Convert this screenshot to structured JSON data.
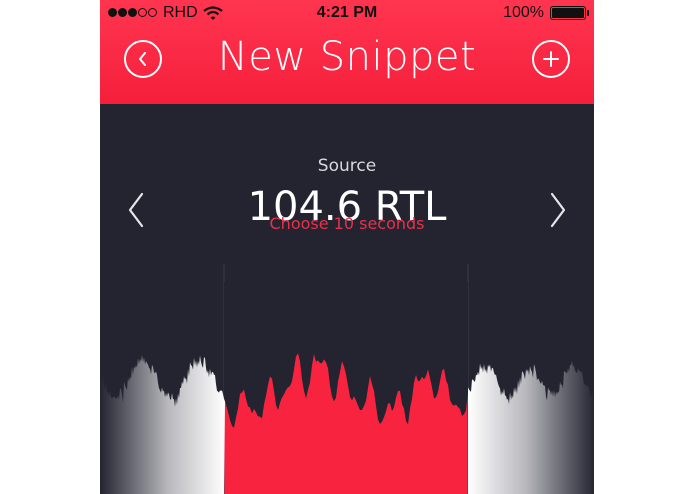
{
  "status_bar": {
    "carrier": "RHD",
    "time": "4:21 PM",
    "battery": "100%",
    "signal_bars_filled": 3,
    "signal_bars_total": 5
  },
  "header": {
    "title": "New Snippet",
    "back_icon": "chevron-left-circle-icon",
    "add_icon": "plus-circle-icon"
  },
  "source": {
    "label": "Source",
    "value": "104.6 RTL",
    "prev_icon": "chevron-left-icon",
    "next_icon": "chevron-right-icon"
  },
  "selector": {
    "hint": "Choose 10 seconds"
  },
  "colors": {
    "accent": "#f8243f",
    "background": "#232430",
    "text": "#ffffff",
    "hint": "#e8304a"
  }
}
